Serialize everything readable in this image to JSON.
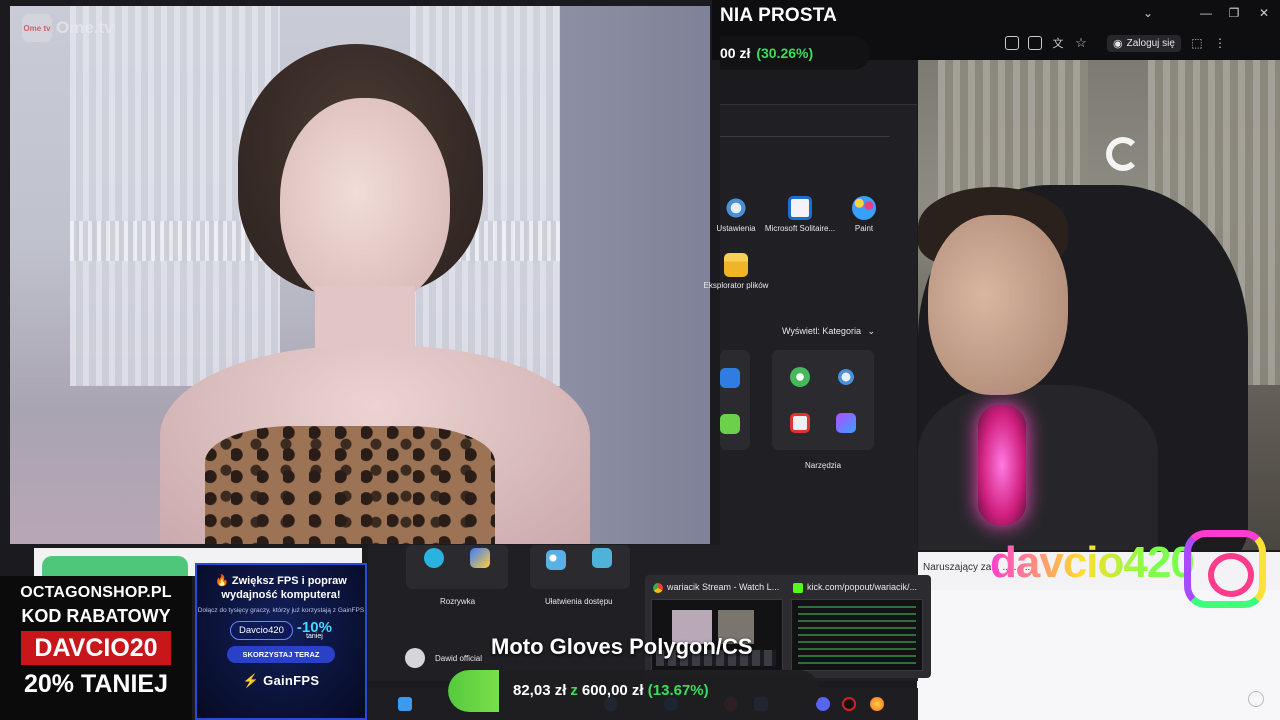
{
  "left_video": {
    "logo_text": "Ome.tv",
    "logo_badge": "Ome tv"
  },
  "stream_window": {
    "title": "NIA PROSTA",
    "donation_amount": "00 zł",
    "donation_percent": "(30.26%)",
    "login_label": "Zaloguj się",
    "window_controls": {
      "collapse": "⌄",
      "minimize": "—",
      "maximize": "❐",
      "close": "✕"
    }
  },
  "start_menu": {
    "apps": [
      {
        "label": "Ustawienia",
        "icon": "gear-icon",
        "color": "#4a90d9"
      },
      {
        "label": "Microsoft Solitaire...",
        "icon": "cards-icon",
        "color": "#1f6fd1"
      },
      {
        "label": "Paint",
        "icon": "palette-icon",
        "color": "#3aa0ff"
      },
      {
        "label": "Eksplorator plików",
        "icon": "folder-icon",
        "color": "#f5c242"
      }
    ],
    "view_label": "Wyświetl: Kategoria",
    "groups": [
      {
        "label": "Narzędzia"
      },
      {
        "label": "Rozrywka"
      },
      {
        "label": "Ułatwienia dostępu"
      }
    ],
    "user_name": "Dawid official"
  },
  "overlay": {
    "channel_name": "davcio420",
    "chat_text": "Naruszający za... ... ... ...",
    "promo": {
      "line1": "OCTAGONSHOP.PL",
      "line2": "KOD RABATOWY",
      "code": "DAVCIO20",
      "line4": "20% TANIEJ"
    },
    "gainfps": {
      "headline": "🔥 Zwiększ FPS i popraw wydajność komputera!",
      "sub": "Dołącz do tysięcy graczy, którzy już korzystają z GainFPS",
      "code": "Davcio420",
      "discount": "-10%",
      "discount_note": "taniej",
      "cta": "SKORZYSTAJ TERAZ",
      "brand": "GainFPS"
    },
    "goal": {
      "product": "Moto Gloves Polygon/CS",
      "current": "82,03 zł",
      "separator": "z",
      "target": "600,00 zł",
      "percent": "(13.67%)",
      "progress": 0.1367
    }
  },
  "taskbar_previews": [
    {
      "title": "wariacik Stream - Watch L..."
    },
    {
      "title": "kick.com/popout/wariacik/..."
    }
  ],
  "colors": {
    "accent_green": "#3ddc5a",
    "promo_red": "#c8161b",
    "gain_blue": "#2a4bd6"
  }
}
